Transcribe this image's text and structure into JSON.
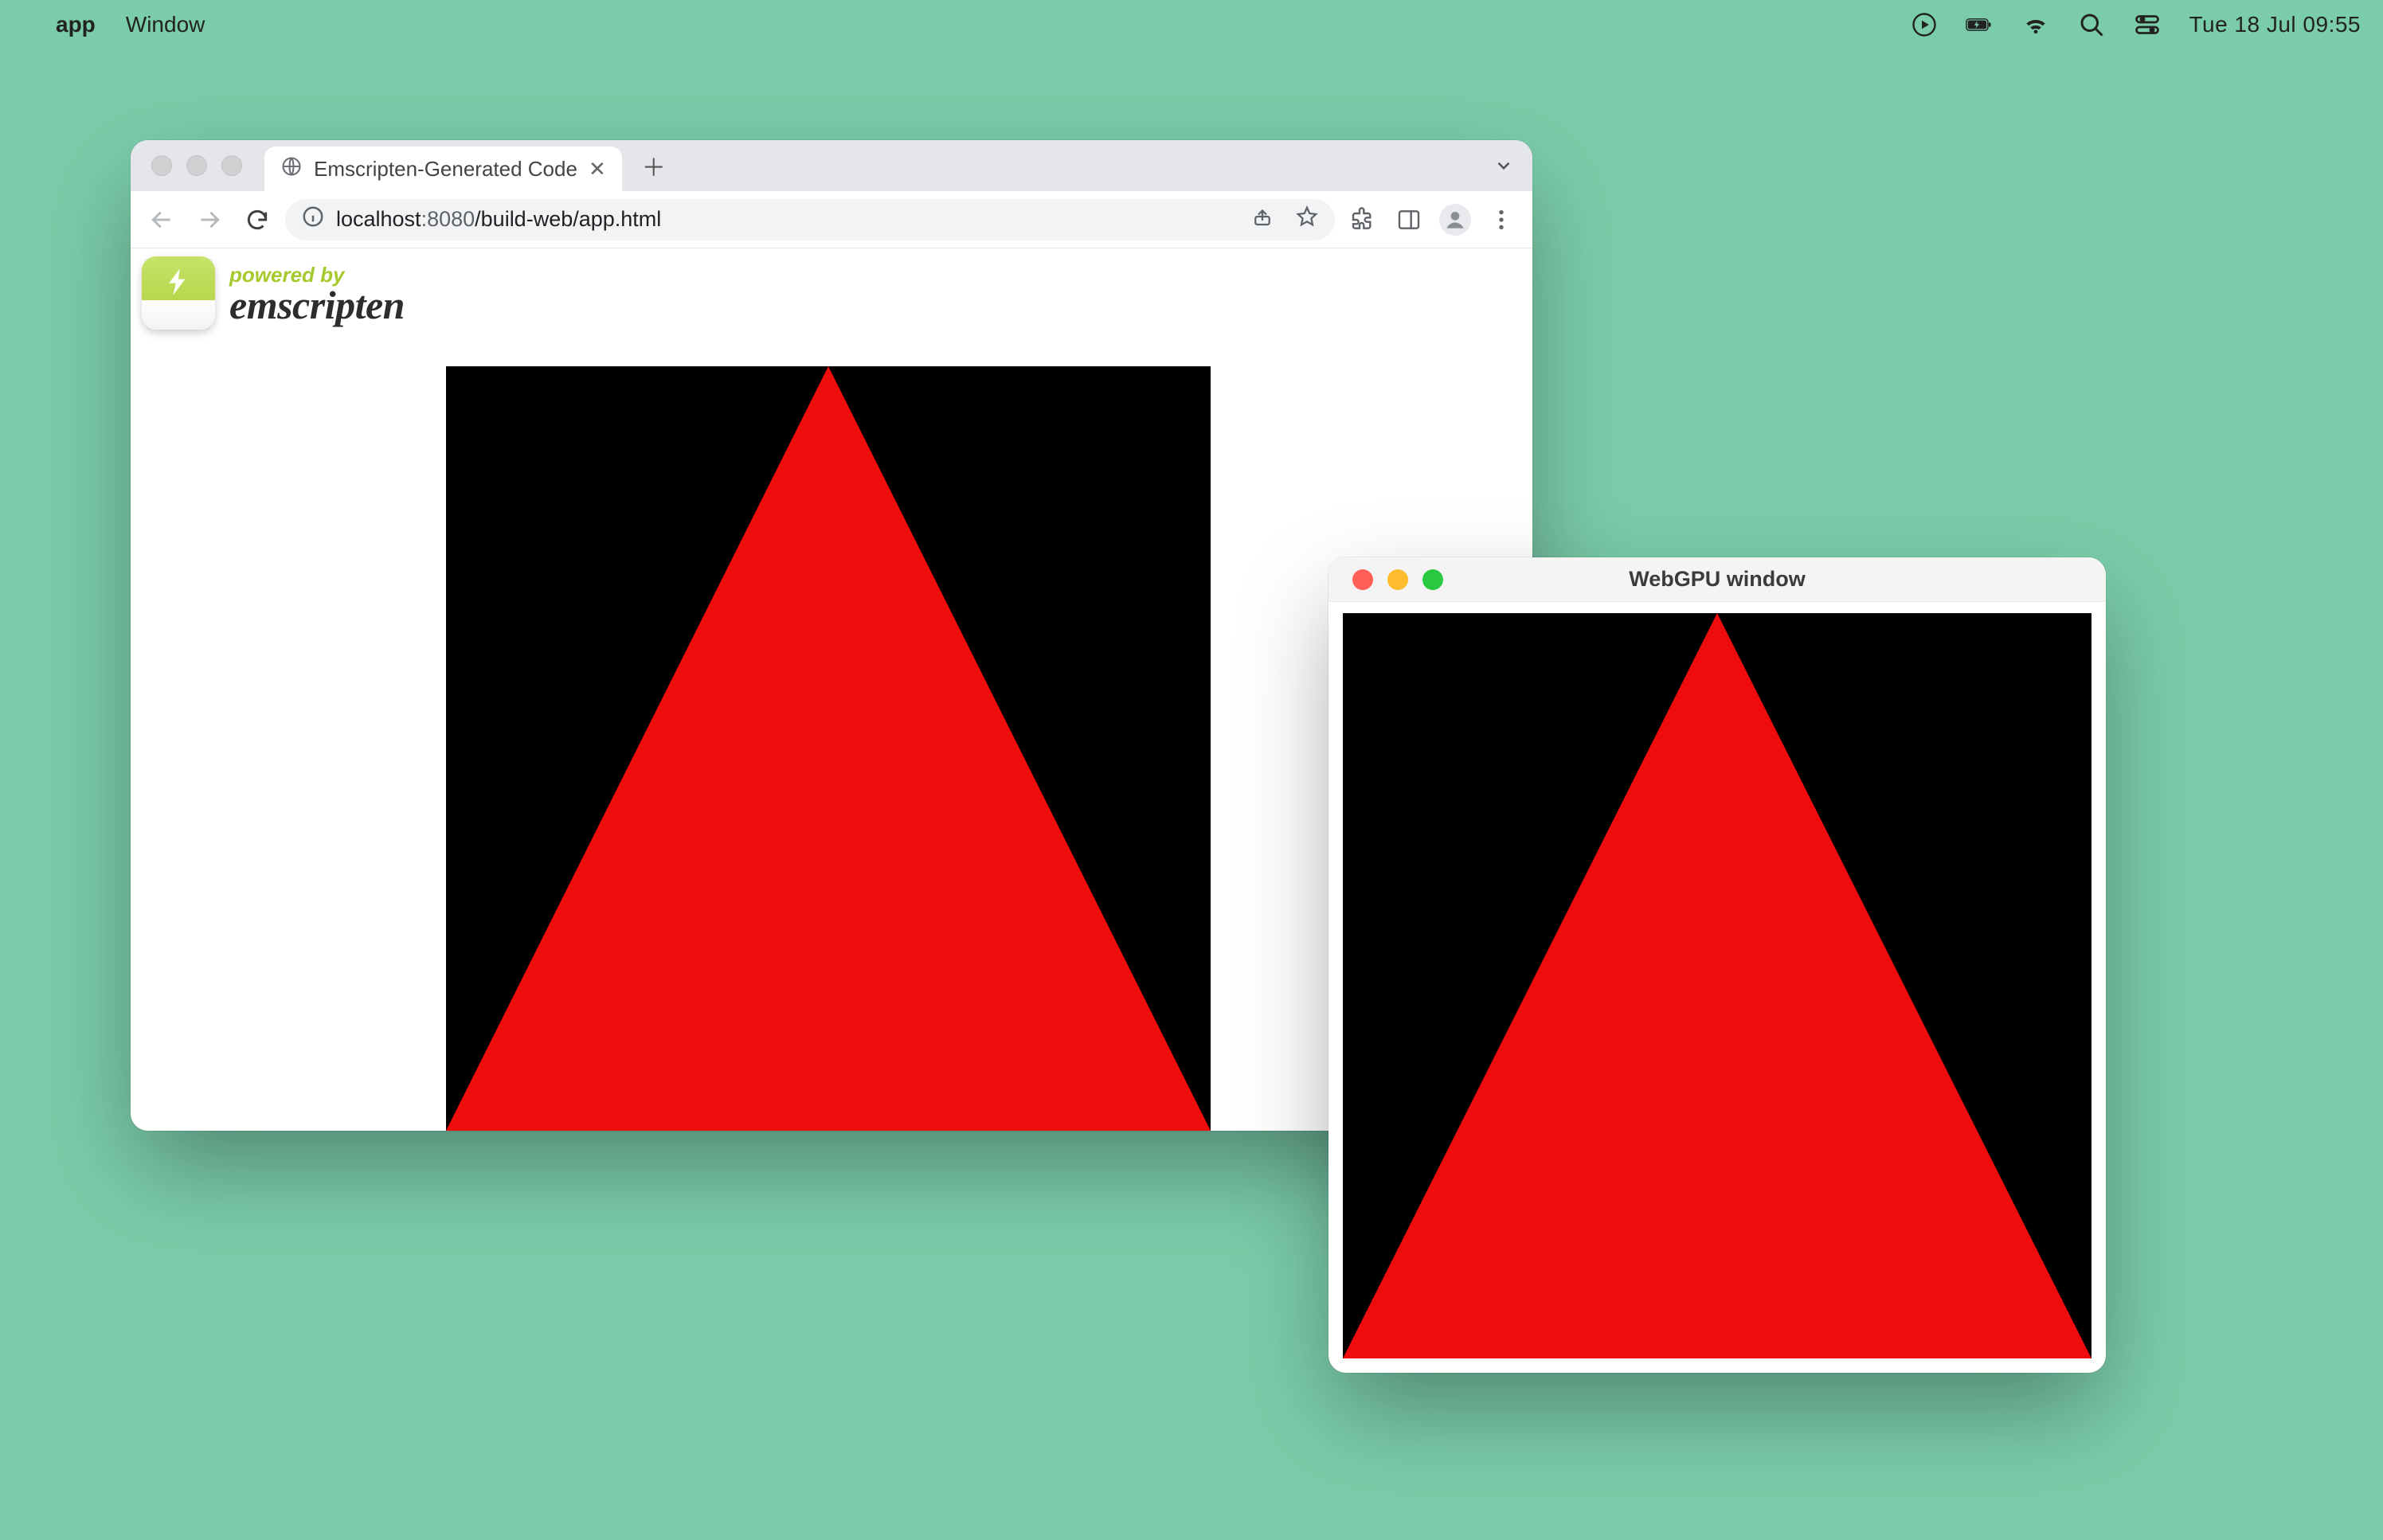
{
  "menubar": {
    "app_name": "app",
    "menu_window": "Window",
    "clock": "Tue 18 Jul  09:55"
  },
  "browser": {
    "tab_title": "Emscripten-Generated Code",
    "url_host": "localhost",
    "url_port": ":8080",
    "url_path": "/build-web/app.html",
    "em_powered": "powered by",
    "em_name": "emscripten"
  },
  "native_window": {
    "title": "WebGPU window"
  },
  "colors": {
    "desktop_bg": "#7bccaa",
    "triangle": "#ef0c0c",
    "canvas_bg": "#000000"
  }
}
